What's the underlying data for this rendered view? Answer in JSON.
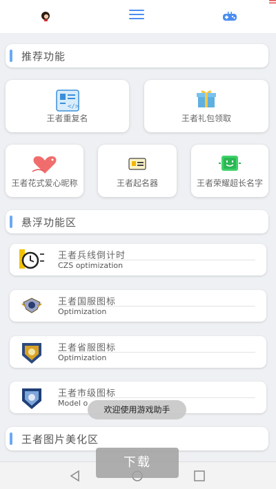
{
  "topbar": {
    "icons": [
      "avatar-icon",
      "menu-icon",
      "gamepad-icon"
    ],
    "accent": "#4a8df0"
  },
  "sections": {
    "recommended": "推荐功能",
    "floating": "悬浮功能区",
    "beautify": "王者图片美化区"
  },
  "recommended": {
    "cards": [
      {
        "label": "王者重复名",
        "icon": "code-board-icon"
      },
      {
        "label": "王者礼包领取",
        "icon": "gift-icon"
      },
      {
        "label": "王者花式爱心昵称",
        "icon": "heart-icon"
      },
      {
        "label": "王者起名器",
        "icon": "id-card-icon"
      },
      {
        "label": "王者荣耀超长名字",
        "icon": "smile-screen-icon"
      }
    ]
  },
  "floating": {
    "rows": [
      {
        "title": "王者兵线倒计时",
        "sub": "CZS optimization",
        "icon": "clock-icon"
      },
      {
        "title": "王者国服图标",
        "sub": "Optimization",
        "icon": "national-badge-icon"
      },
      {
        "title": "王者省服图标",
        "sub": "Optimization",
        "icon": "province-badge-icon"
      },
      {
        "title": "王者市级图标",
        "sub": "Model o",
        "icon": "city-badge-icon"
      }
    ]
  },
  "toast": "欢迎使用游戏助手",
  "download_button": "下载",
  "navbar": {
    "icons": [
      "back-icon",
      "home-icon",
      "recent-apps-icon"
    ]
  }
}
